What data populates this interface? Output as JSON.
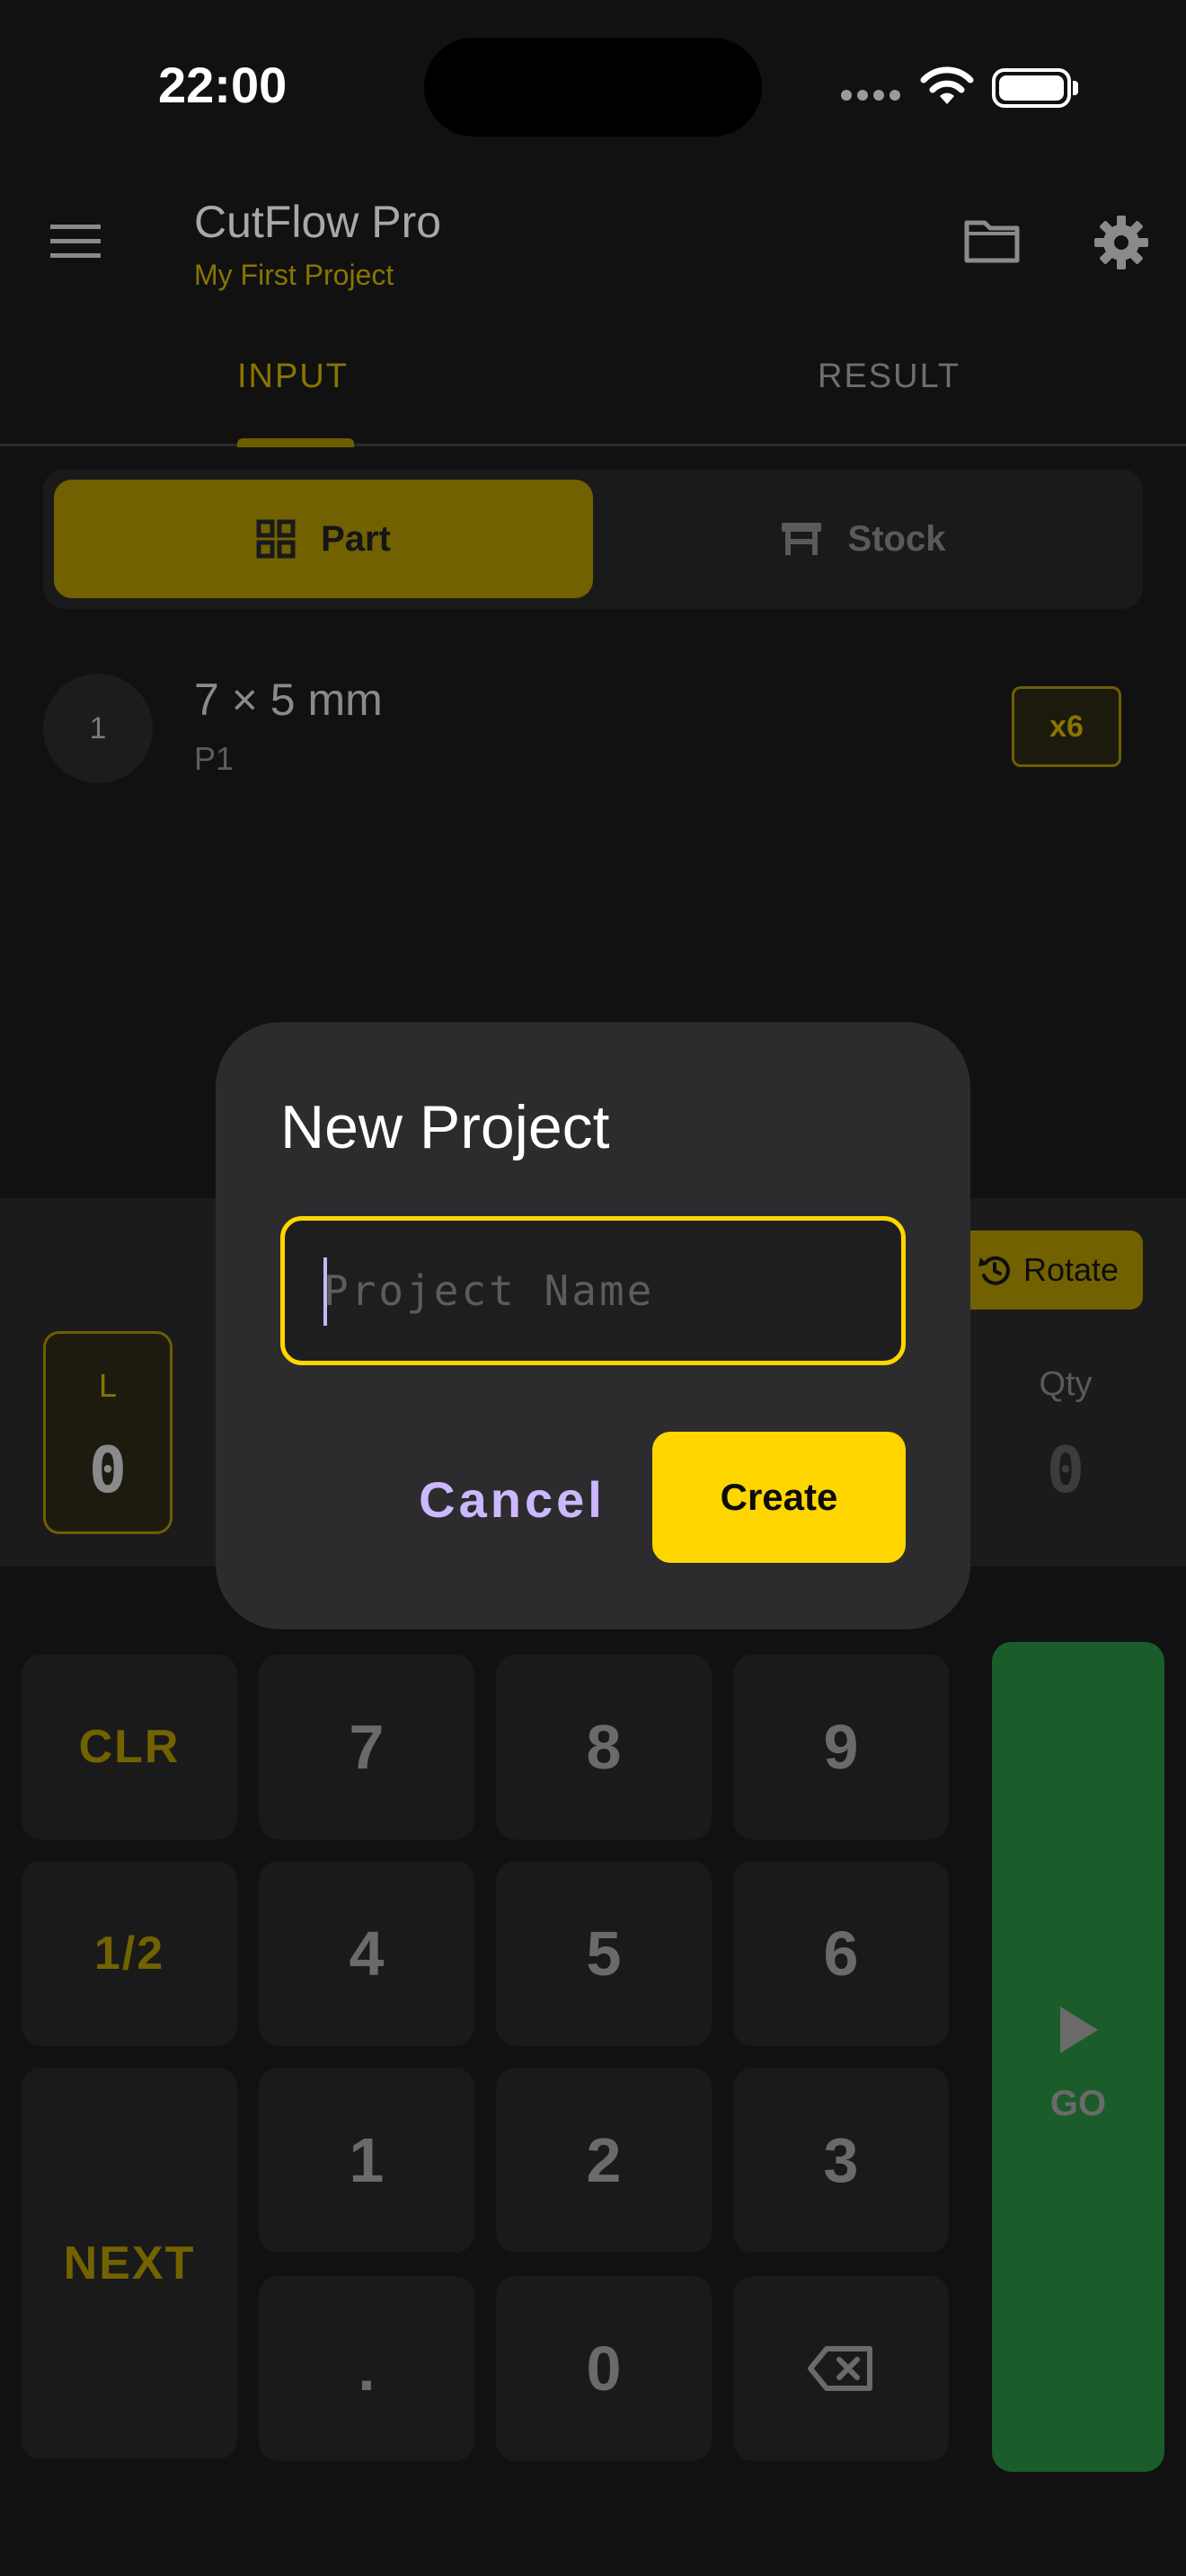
{
  "status_bar": {
    "time": "22:00"
  },
  "header": {
    "title": "CutFlow Pro",
    "subtitle": "My First Project"
  },
  "tabs": [
    {
      "label": "INPUT",
      "active": true
    },
    {
      "label": "RESULT",
      "active": false
    }
  ],
  "segmented": {
    "part_label": "Part",
    "stock_label": "Stock",
    "selected": "Part"
  },
  "parts": [
    {
      "index": "1",
      "dimensions": "7 × 5 mm",
      "name": "P1",
      "qty_badge": "x6"
    }
  ],
  "input_panel": {
    "rotate_label": "Rotate",
    "l_label": "L",
    "l_value": "0",
    "qty_label": "Qty",
    "qty_value": "0"
  },
  "keypad": {
    "clr": "CLR",
    "half": "1/2",
    "next": "NEXT",
    "go": "GO",
    "k7": "7",
    "k8": "8",
    "k9": "9",
    "k4": "4",
    "k5": "5",
    "k6": "6",
    "k1": "1",
    "k2": "2",
    "k3": "3",
    "kdot": ".",
    "k0": "0"
  },
  "dialog": {
    "title": "New Project",
    "input_placeholder": "Project Name",
    "input_value": "",
    "cancel_label": "Cancel",
    "create_label": "Create"
  },
  "colors": {
    "accent": "#ffd600",
    "accent_dim": "#716100",
    "go": "#1a5c2a",
    "dialog_bg": "#2c2c2e",
    "cancel": "#cbb8ff"
  }
}
